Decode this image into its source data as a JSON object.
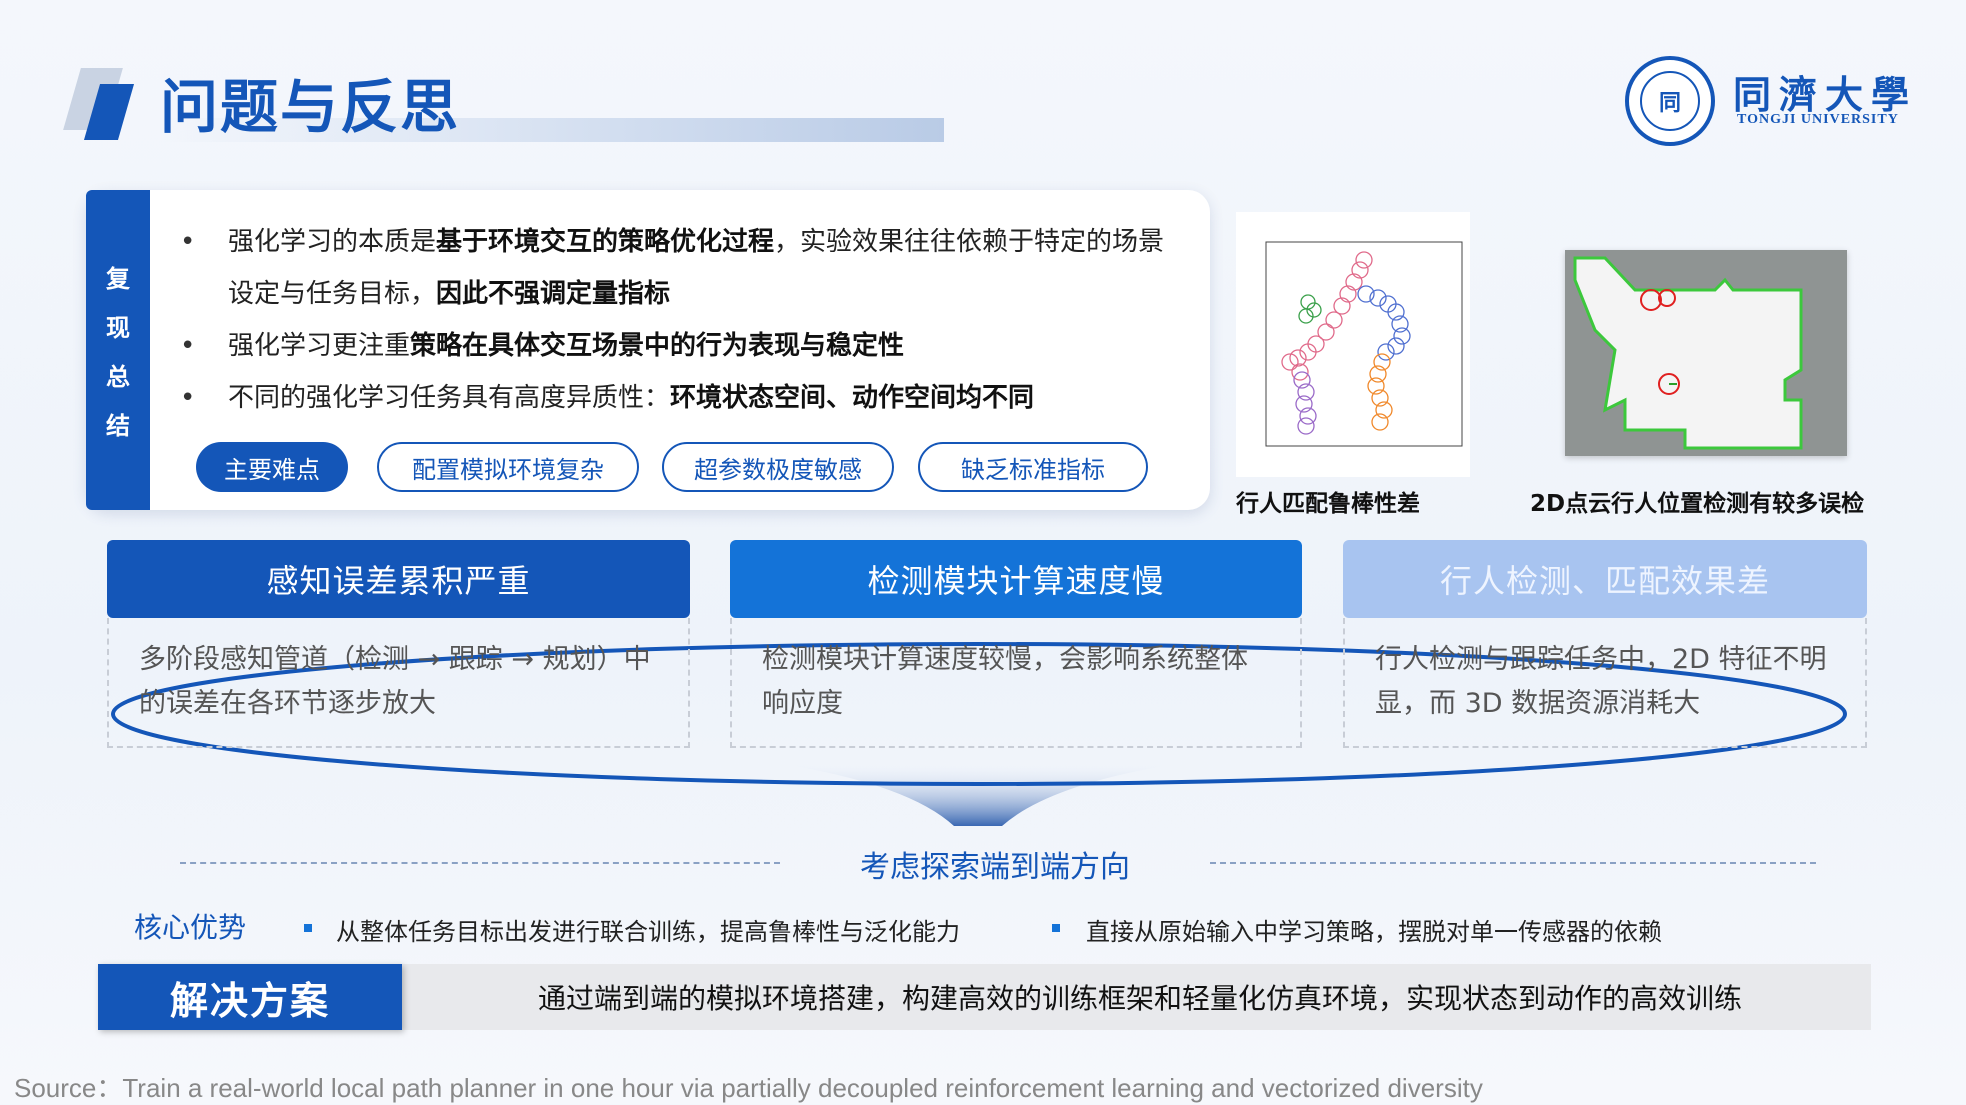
{
  "title": "问题与反思",
  "logo": {
    "seal_glyph": "同",
    "name_cn": "同濟大學",
    "name_en": "TONGJI UNIVERSITY"
  },
  "summary": {
    "side_label": [
      "复",
      "现",
      "总",
      "结"
    ],
    "bullets": [
      {
        "parts": [
          {
            "text": "强化学习的本质是",
            "bold": false
          },
          {
            "text": "基于环境交互的策略优化过程",
            "bold": true
          },
          {
            "text": "，实验效果往往依赖于特定的场景设定与任务目标，",
            "bold": false
          },
          {
            "text": "因此不强调定量指标",
            "bold": true
          }
        ]
      },
      {
        "parts": [
          {
            "text": "强化学习更注重",
            "bold": false
          },
          {
            "text": "策略在具体交互场景中的行为表现与稳定性",
            "bold": true
          }
        ]
      },
      {
        "parts": [
          {
            "text": "不同的强化学习任务具有高度异质性：",
            "bold": false
          },
          {
            "text": "环境状态空间、动作空间均不同",
            "bold": true
          }
        ]
      }
    ],
    "tags": [
      "主要难点",
      "配置模拟环境复杂",
      "超参数极度敏感",
      "缺乏标准指标"
    ]
  },
  "figures": {
    "plot_caption": "行人匹配鲁棒性差",
    "map_caption": "2D点云行人位置检测有较多误检"
  },
  "problems": [
    {
      "title": "感知误差累积严重",
      "body": "多阶段感知管道（检测 → 跟踪 → 规划）中的误差在各环节逐步放大"
    },
    {
      "title": "检测模块计算速度慢",
      "body": "检测模块计算速度较慢，会影响系统整体响应度"
    },
    {
      "title": "行人检测、匹配效果差",
      "body": "行人检测与跟踪任务中，2D 特征不明显，而 3D 数据资源消耗大"
    }
  ],
  "direction": "考虑探索端到端方向",
  "core": {
    "label": "核心优势",
    "items": [
      "从整体任务目标出发进行联合训练，提高鲁棒性与泛化能力",
      "直接从原始输入中学习策略，摆脱对单一传感器的依赖"
    ]
  },
  "solution": {
    "label": "解决方案",
    "text": "通过端到端的模拟环境搭建，构建高效的训练框架和轻量化仿真环境，实现状态到动作的高效训练"
  },
  "source": "Source：Train a real-world local path planner in one hour via partially decoupled reinforcement learning and vectorized diversity",
  "colors": {
    "primary": "#1456b8",
    "secondary": "#1473d8",
    "light": "#a8c4f0"
  }
}
